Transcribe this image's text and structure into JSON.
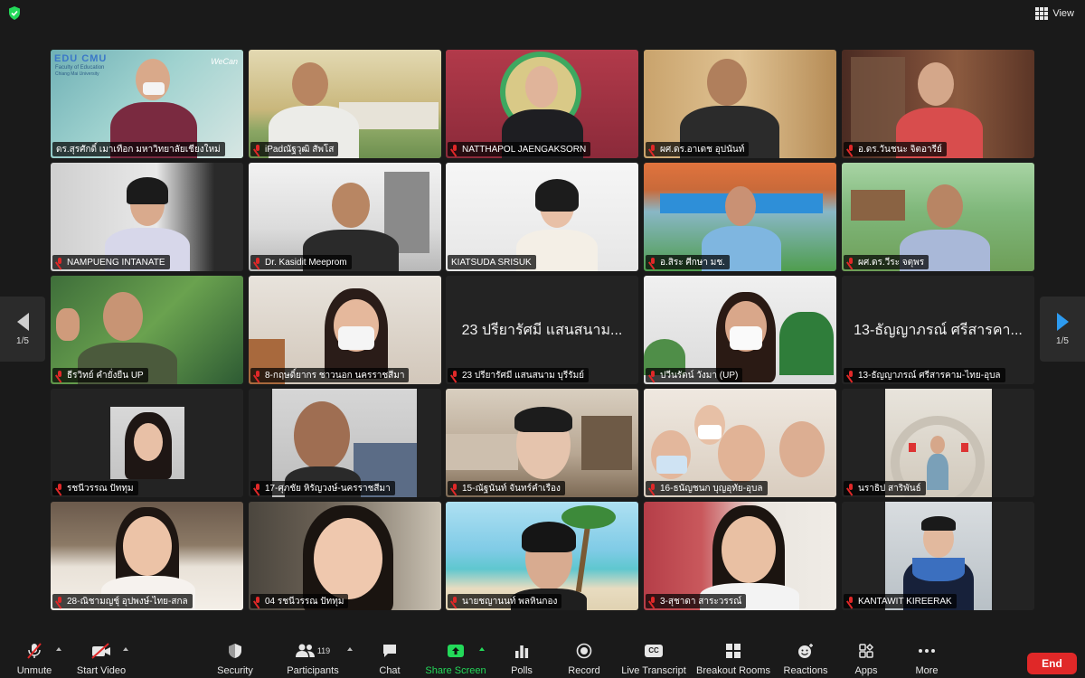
{
  "top": {
    "view_label": "View"
  },
  "gallery": {
    "page_indicator_left": "1/5",
    "page_indicator_right": "1/5",
    "tiles": [
      {
        "name": "ดร.สุรศักดิ์ เมาเทือก มหาวิทยาลัยเชียงใหม่",
        "active": true,
        "overlay": [
          "EDU CMU",
          "Faculty of Education",
          "Chiang Mai University",
          "WeCan"
        ]
      },
      {
        "name": "iPadณัฐวุฒิ สัพโส"
      },
      {
        "name": "NATTHAPOL JAENGAKSORN"
      },
      {
        "name": "ผศ.ดร.อาเดช อุปนันท์"
      },
      {
        "name": "อ.ดร.วันชนะ จิตอารีย์"
      },
      {
        "name": "NAMPUENG INTANATE"
      },
      {
        "name": "Dr. Kasidit Meeprom"
      },
      {
        "name": "KIATSUDA SRISUK"
      },
      {
        "name": "อ.สิระ ศีกษา มช."
      },
      {
        "name": "ผศ.ดร.วีระ จตุพร"
      },
      {
        "name": "ธีรวิทย์ คำยั่งยืน UP"
      },
      {
        "name": "8-กฤษดิ์ยากร ชาวนอก นครราชสีมา"
      },
      {
        "name": "23 ปรียารัศมี แสนสนาม บุรีรัมย์",
        "big_name": "23 ปรียารัศมี แสนสนาม..."
      },
      {
        "name": "ปวีนรัตน์ วังมา (UP)"
      },
      {
        "name": "13-ธัญญาภรณ์ ศรีสารคาม-ไทย-อุบล",
        "big_name": "13-ธัญญาภรณ์ ศรีสารคา..."
      },
      {
        "name": "รชนีวรรณ ปัททุม"
      },
      {
        "name": "17-ศุภชัย หิรัญวงษ์-นครราชสีมา"
      },
      {
        "name": "15-ณัฐนันท์ จันทร์คำเรือง"
      },
      {
        "name": "16-ธนัญชนก บุญอุทัย-อุบล"
      },
      {
        "name": "นราธิป สาริพันธ์"
      },
      {
        "name": "28-ณิชามญชุ์ อุปพงษ์-ไทย-สกล"
      },
      {
        "name": "04 รชนีวรรณ ปัททุม"
      },
      {
        "name": "นายชญานนท์ พลหินกอง"
      },
      {
        "name": "3-สุชาดา สาระวรรณ์"
      },
      {
        "name": "KANTAWIT KIREERAK"
      }
    ]
  },
  "toolbar": {
    "unmute": "Unmute",
    "start_video": "Start Video",
    "security": "Security",
    "participants": "Participants",
    "participants_count": "119",
    "chat": "Chat",
    "share_screen": "Share Screen",
    "polls": "Polls",
    "record": "Record",
    "live_transcript": "Live Transcript",
    "live_transcript_badge": "CC",
    "breakout_rooms": "Breakout Rooms",
    "reactions": "Reactions",
    "apps": "Apps",
    "more": "More",
    "end": "End"
  },
  "colors": {
    "accent_green": "#23d959",
    "end_red": "#e02828",
    "arrow_blue": "#2d9bf0"
  }
}
